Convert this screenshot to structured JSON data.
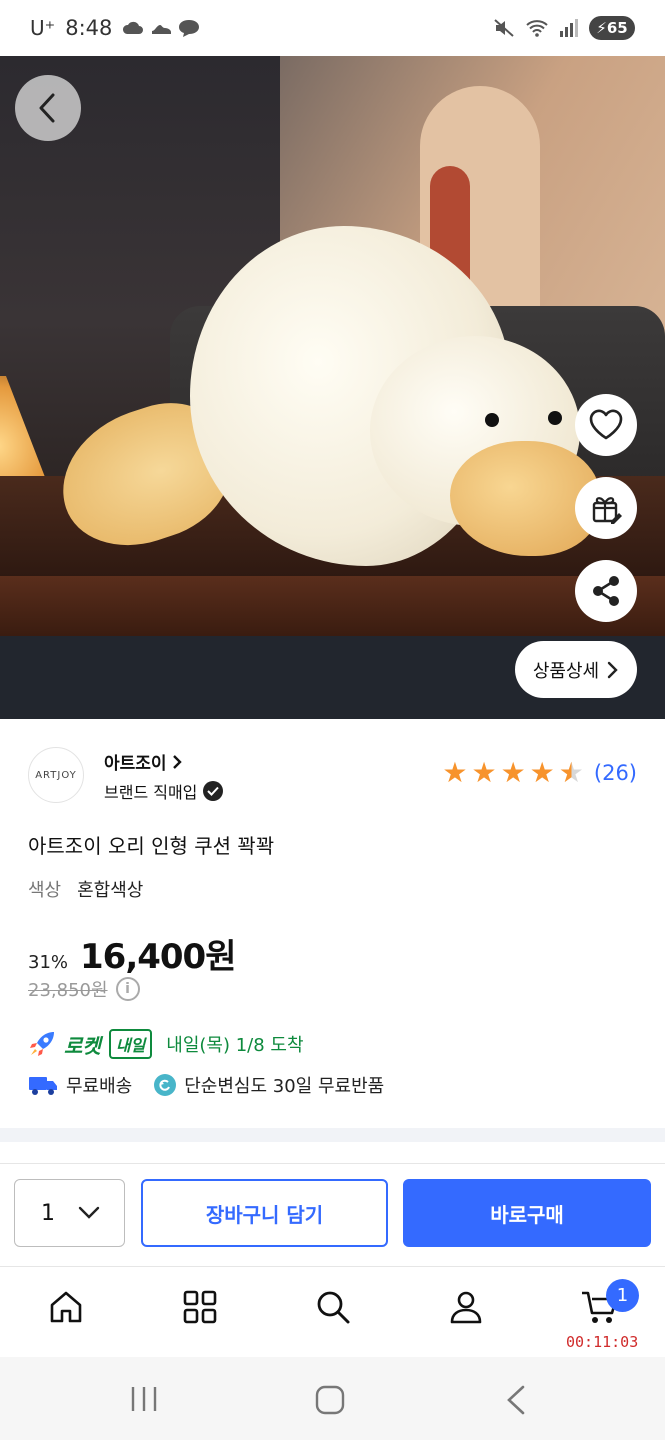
{
  "status_bar": {
    "carrier": "U⁺",
    "time": "8:48",
    "battery": "65"
  },
  "hero": {
    "slide_count": 7,
    "active_slide": 1,
    "detail_button_label": "상품상세"
  },
  "brand": {
    "logo_text": "ARTJOY",
    "name": "아트조이",
    "tag": "브랜드 직매입"
  },
  "rating": {
    "stars": 4.5,
    "review_count": "(26)"
  },
  "product": {
    "title": "아트조이 오리 인형 쿠션 꽉꽉",
    "option_label": "색상",
    "option_value": "혼합색상",
    "discount": "31%",
    "price": "16,400원",
    "original_price": "23,850원"
  },
  "delivery": {
    "rocket_label": "로켓",
    "naeil_badge": "내일",
    "arrival": "내일(목) 1/8 도착",
    "free_shipping": "무료배송",
    "free_return": "단순변심도 30일 무료반품"
  },
  "purchase_bar": {
    "quantity": "1",
    "cart_label": "장바구니 담기",
    "buy_label": "바로구매"
  },
  "bottom_nav": {
    "cart_count": "1",
    "timer": "00:11:03"
  },
  "colors": {
    "accent": "#346aff",
    "rocket_green": "#0e8a3d",
    "star": "#f7932c",
    "timer_red": "#d02b2b"
  }
}
